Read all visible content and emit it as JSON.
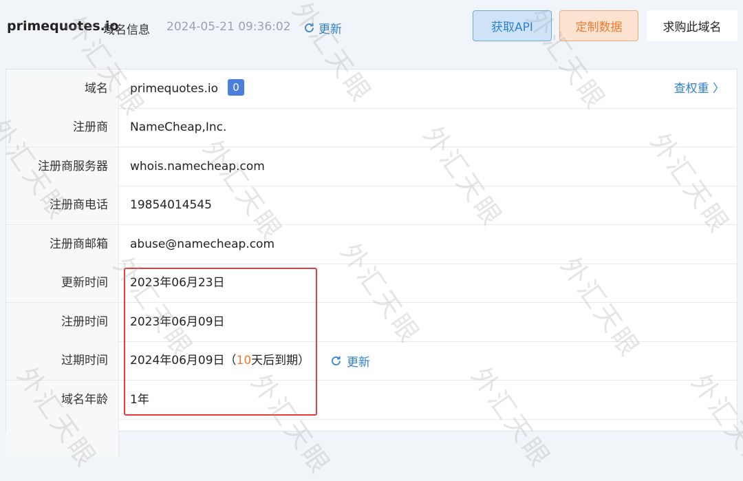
{
  "header": {
    "domain": "primequotes.io",
    "title_suffix": "域名信息",
    "timestamp": "2024-05-21 09:36:02",
    "refresh_label": "更新",
    "api_button": "获取API",
    "custom_button": "定制数据",
    "buy_button": "求购此域名"
  },
  "rows": {
    "domain": {
      "label": "域名",
      "value": "primequotes.io",
      "badge": "0",
      "link": "查权重 〉"
    },
    "registrar": {
      "label": "注册商",
      "value": "NameCheap,Inc."
    },
    "registrar_server": {
      "label": "注册商服务器",
      "value": "whois.namecheap.com"
    },
    "registrar_phone": {
      "label": "注册商电话",
      "value": "19854014545"
    },
    "registrar_email": {
      "label": "注册商邮箱",
      "value": "abuse@namecheap.com"
    },
    "updated": {
      "label": "更新时间",
      "value": "2023年06月23日"
    },
    "registered": {
      "label": "注册时间",
      "value": "2023年06月09日"
    },
    "expiry": {
      "label": "过期时间",
      "value_prefix": "2024年06月09日（",
      "days": "10",
      "value_suffix": "天后到期）",
      "refresh_label": "更新"
    },
    "age": {
      "label": "域名年龄",
      "value": "1年"
    }
  },
  "watermark": "外汇天眼",
  "colors": {
    "accent_blue": "#2f80d1",
    "accent_orange": "#ef7b32",
    "highlight_red": "#e43b3b"
  }
}
